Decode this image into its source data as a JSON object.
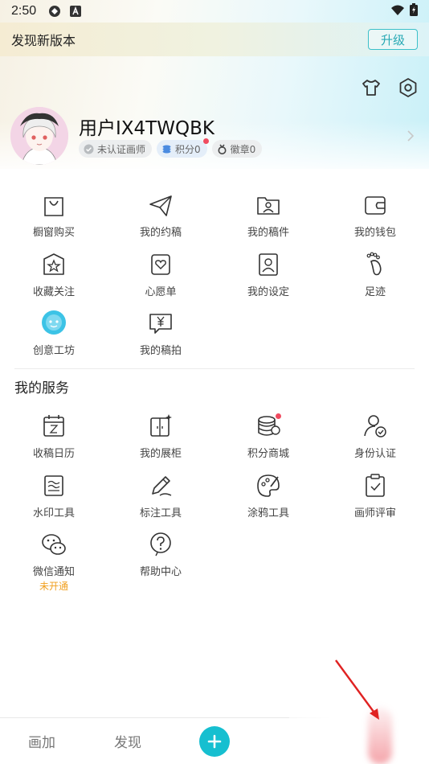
{
  "status_bar": {
    "time": "2:50"
  },
  "banner": {
    "text": "发现新版本",
    "upgrade_label": "升级"
  },
  "profile": {
    "username": "用户IX4TWQBK",
    "badge_certified": "未认证画师",
    "badge_points": "积分0",
    "badge_medals": "徽章0"
  },
  "menu": [
    {
      "label": "橱窗购买",
      "icon": "shopping-bag-icon"
    },
    {
      "label": "我的约稿",
      "icon": "paper-plane-icon"
    },
    {
      "label": "我的稿件",
      "icon": "folder-user-icon"
    },
    {
      "label": "我的钱包",
      "icon": "wallet-icon"
    },
    {
      "label": "收藏关注",
      "icon": "star-box-icon"
    },
    {
      "label": "心愿单",
      "icon": "heart-list-icon"
    },
    {
      "label": "我的设定",
      "icon": "portrait-icon"
    },
    {
      "label": "足迹",
      "icon": "footprint-icon"
    },
    {
      "label": "创意工坊",
      "icon": "creative-blob-icon"
    },
    {
      "label": "我的稿拍",
      "icon": "yen-board-icon"
    }
  ],
  "services": {
    "title": "我的服务",
    "items": [
      {
        "label": "收稿日历",
        "icon": "calendar-icon"
      },
      {
        "label": "我的展柜",
        "icon": "showcase-icon"
      },
      {
        "label": "积分商城",
        "icon": "coins-icon"
      },
      {
        "label": "身份认证",
        "icon": "user-verify-icon"
      },
      {
        "label": "水印工具",
        "icon": "watermark-icon"
      },
      {
        "label": "标注工具",
        "icon": "pen-icon"
      },
      {
        "label": "涂鸦工具",
        "icon": "palette-icon"
      },
      {
        "label": "画师评审",
        "icon": "clipboard-check-icon"
      },
      {
        "label": "微信通知",
        "icon": "wechat-icon",
        "sub": "未开通"
      },
      {
        "label": "帮助中心",
        "icon": "help-icon"
      }
    ]
  },
  "bottom_nav": {
    "tab1": "画加",
    "tab2": "发现"
  },
  "colors": {
    "accent": "#16bfd0",
    "upgrade": "#3cc0c9",
    "notice": "#f0a020",
    "dot": "#f04b60"
  }
}
